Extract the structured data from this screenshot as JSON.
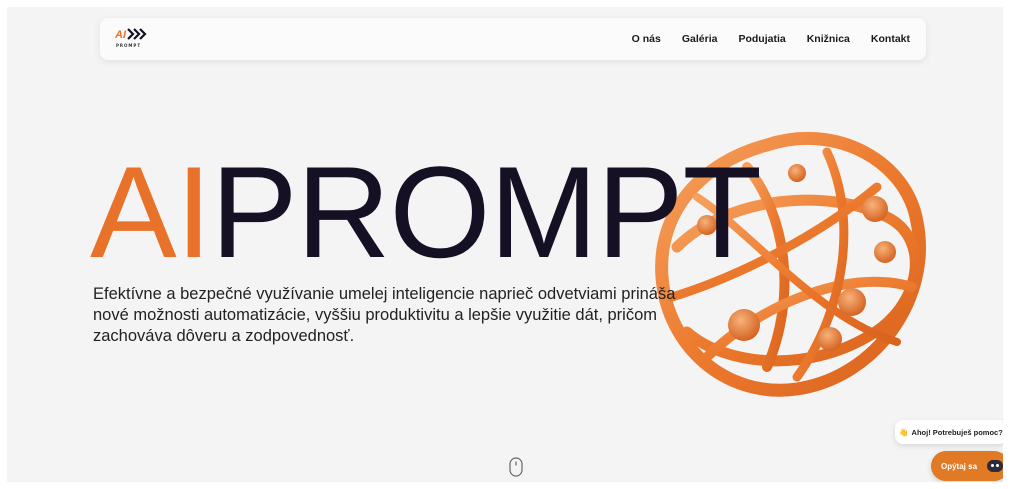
{
  "brand": {
    "logo_text": "AI",
    "logo_word": "PROMPT"
  },
  "nav": {
    "items": [
      {
        "label": "O nás"
      },
      {
        "label": "Galéria"
      },
      {
        "label": "Podujatia"
      },
      {
        "label": "Knižnica"
      },
      {
        "label": "Kontakt"
      }
    ]
  },
  "hero": {
    "title_part1": "AI",
    "title_part2": "PROMPT",
    "description": "Efektívne a bezpečné využívanie umelej inteligencie naprieč odvetviami prináša nové možnosti automatizácie, vyššiu produktivitu a lepšie využitie dát, pričom zachováva dôveru a zodpovednosť."
  },
  "chat": {
    "bubble_icon": "👋",
    "bubble_text": "Ahoj! Potrebuješ pomoc?",
    "close_symbol": "×",
    "button_label": "Opýtaj sa"
  },
  "colors": {
    "accent": "#e8722a",
    "title_dark": "#151024",
    "background": "#f4f4f4",
    "chat_button": "#e07a24"
  }
}
